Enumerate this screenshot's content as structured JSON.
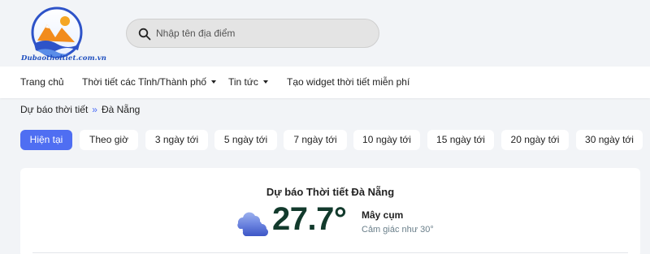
{
  "header": {
    "logo_text": "Dubaothoitiet.com.vn",
    "search": {
      "placeholder": "Nhập tên địa điểm",
      "value": ""
    }
  },
  "nav": {
    "items": [
      {
        "label": "Trang chủ",
        "dropdown": false
      },
      {
        "label": "Thời tiết các Tỉnh/Thành phố",
        "dropdown": true
      },
      {
        "label": "Tin tức",
        "dropdown": true
      },
      {
        "label": "Tạo widget thời tiết miễn phí",
        "dropdown": false
      }
    ]
  },
  "breadcrumb": {
    "root": "Dự báo thời tiết",
    "separator": "»",
    "current": "Đà Nẵng"
  },
  "tabs": [
    {
      "label": "Hiện tại",
      "active": true
    },
    {
      "label": "Theo giờ"
    },
    {
      "label": "3 ngày tới"
    },
    {
      "label": "5 ngày tới"
    },
    {
      "label": "7 ngày tới"
    },
    {
      "label": "10 ngày tới"
    },
    {
      "label": "15 ngày tới"
    },
    {
      "label": "20 ngày tới"
    },
    {
      "label": "30 ngày tới"
    }
  ],
  "current_weather": {
    "title": "Dự báo Thời tiết Đà Nẵng",
    "temperature": "27.7°",
    "condition": "Mây cụm",
    "feels_like": "Cảm giác như 30°",
    "icon": "cloud-icon"
  },
  "colors": {
    "accent": "#4f6ef2",
    "temperature_text": "#123a2c",
    "logo_text": "#1f4fbf"
  }
}
